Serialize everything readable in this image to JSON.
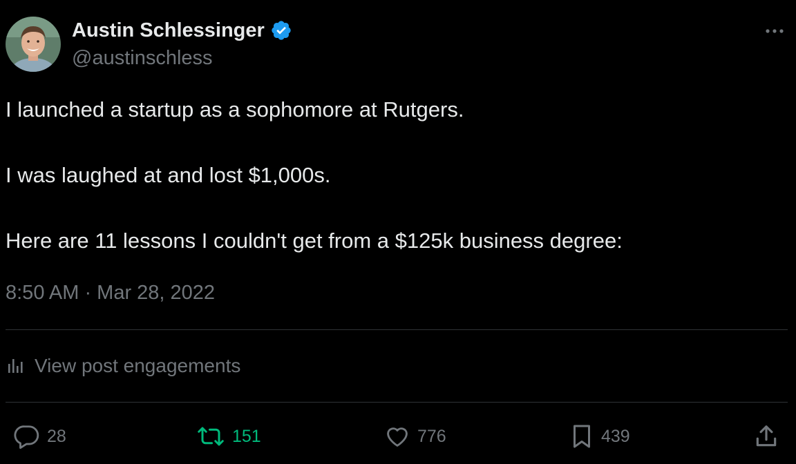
{
  "author": {
    "name": "Austin Schlessinger",
    "handle": "@austinschless",
    "verified": true,
    "avatar_icon": "person-avatar"
  },
  "tweet": {
    "lines": [
      "I launched a startup as a sophomore at Rutgers.",
      "I was laughed at and lost $1,000s.",
      "Here are 11 lessons I couldn't get from a $125k business degree:"
    ],
    "timestamp": "8:50 AM · Mar 28, 2022"
  },
  "engagements_link": "View post engagements",
  "actions": {
    "reply": {
      "icon": "reply-icon",
      "count": "28"
    },
    "retweet": {
      "icon": "retweet-icon",
      "count": "151",
      "active": true
    },
    "like": {
      "icon": "heart-icon",
      "count": "776"
    },
    "bookmark": {
      "icon": "bookmark-icon",
      "count": "439"
    },
    "share": {
      "icon": "share-icon"
    }
  },
  "colors": {
    "background": "#000000",
    "text_primary": "#e7e9ea",
    "text_secondary": "#71767b",
    "verified_blue": "#1d9bf0",
    "retweet_green": "#00ba7c",
    "divider": "#2f3336"
  }
}
